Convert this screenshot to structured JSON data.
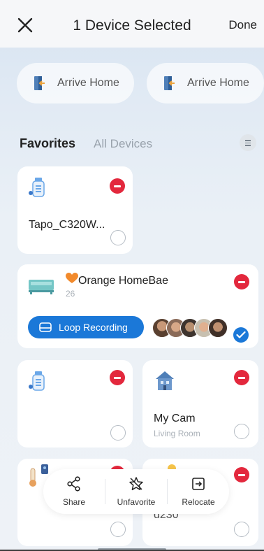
{
  "header": {
    "title": "1 Device Selected",
    "done_label": "Done",
    "close_icon": "close-icon"
  },
  "scenes": [
    {
      "label": "Arrive Home",
      "icon": "door-arrive-icon"
    },
    {
      "label": "Arrive Home",
      "icon": "door-arrive-icon"
    }
  ],
  "tabs": {
    "favorites": "Favorites",
    "all_devices": "All Devices",
    "list_icon": "list-icon"
  },
  "devices": [
    {
      "name": "Tapo_C320W...",
      "icon": "camera-icon",
      "selected": false
    },
    {
      "name": "Orange HomeBae",
      "sub": "26",
      "icon": "hub-icon",
      "heart": "orange-heart-icon",
      "selected": true,
      "loop_label": "Loop Recording"
    },
    {
      "name": "",
      "icon": "camera-icon",
      "selected": false
    },
    {
      "name": "My Cam",
      "sub": "Living Room",
      "icon": "home-camera-icon",
      "selected": false
    },
    {
      "name": "",
      "icon": "thermometer-icon",
      "selected": false
    },
    {
      "name": "d230",
      "icon": "bulb-icon",
      "selected": false
    }
  ],
  "actions": [
    {
      "label": "Share",
      "icon": "share-icon"
    },
    {
      "label": "Unfavorite",
      "icon": "unfavorite-star-icon"
    },
    {
      "label": "Relocate",
      "icon": "relocate-icon"
    }
  ],
  "colors": {
    "accent": "#1b78d8",
    "remove": "#e3283d",
    "heart": "#f28a2c"
  }
}
